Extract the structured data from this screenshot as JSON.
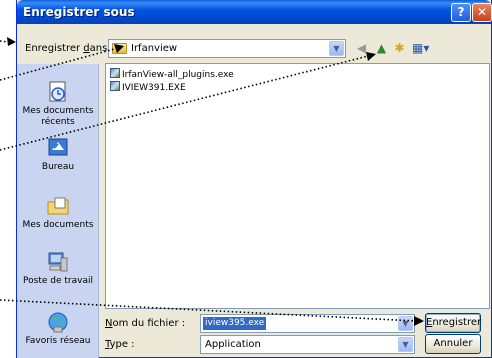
{
  "window": {
    "title": "Enregistrer sous",
    "help": "?",
    "close": "✕"
  },
  "toolbar": {
    "save_in_label_prefix": "Enregistrer ",
    "save_in_label_key": "d",
    "save_in_label_suffix": "ans:",
    "folder": "Irfanview",
    "icons": [
      "back-icon",
      "up-folder-icon",
      "new-folder-icon",
      "view-menu-icon"
    ]
  },
  "places": [
    {
      "label": "Mes documents récents",
      "icon": "recent-documents-icon"
    },
    {
      "label": "Bureau",
      "icon": "desktop-icon"
    },
    {
      "label": "Mes documents",
      "icon": "my-documents-icon"
    },
    {
      "label": "Poste de travail",
      "icon": "my-computer-icon"
    },
    {
      "label": "Favoris réseau",
      "icon": "network-places-icon"
    }
  ],
  "files": [
    {
      "name": "IrfanView-all_plugins.exe"
    },
    {
      "name": "IVIEW391.EXE"
    }
  ],
  "form": {
    "filename_label_key": "N",
    "filename_label_rest": "om du fichier :",
    "filename_value": "iview395.exe",
    "type_label_key": "T",
    "type_label_rest": "ype :",
    "type_value": "Application"
  },
  "buttons": {
    "save_key": "E",
    "save_rest": "nregistrer",
    "cancel": "Annuler"
  },
  "colors": {
    "titlebar": "#0054e3",
    "places_bg": "#c9d4f0",
    "dialog_bg": "#ece9d8",
    "selection": "#316ac5"
  }
}
